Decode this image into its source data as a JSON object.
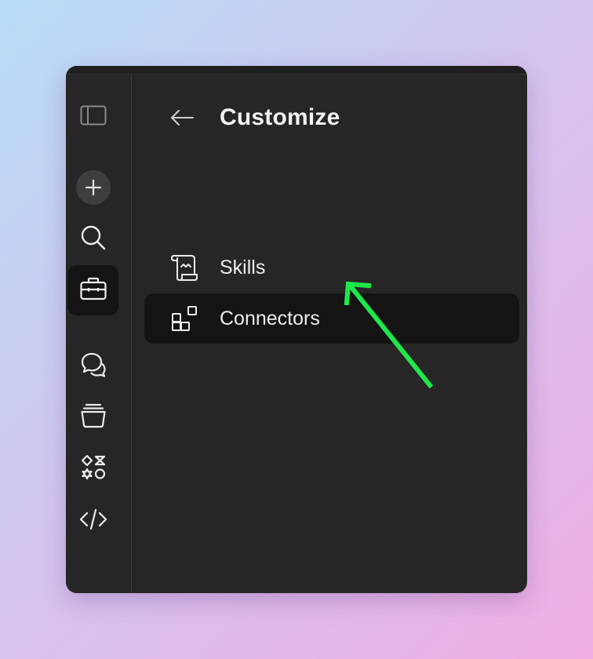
{
  "window": {
    "background": "#262626",
    "rail_active_bg": "#141414"
  },
  "sidebar": {
    "items": [
      {
        "name": "sidebar-toggle",
        "icon": "sidebar-panel-icon"
      },
      {
        "name": "new-chat",
        "icon": "plus-icon"
      },
      {
        "name": "search",
        "icon": "search-icon"
      },
      {
        "name": "customize",
        "icon": "briefcase-icon",
        "active": true
      },
      {
        "name": "chats",
        "icon": "chat-bubbles-icon"
      },
      {
        "name": "projects",
        "icon": "stack-icon"
      },
      {
        "name": "artifacts",
        "icon": "shapes-icon"
      },
      {
        "name": "code",
        "icon": "code-icon"
      }
    ]
  },
  "panel": {
    "back_icon": "arrow-left-icon",
    "title": "Customize",
    "items": [
      {
        "label": "Skills",
        "icon": "scroll-icon",
        "selected": false
      },
      {
        "label": "Connectors",
        "icon": "connectors-grid-icon",
        "selected": true
      }
    ]
  },
  "annotation": {
    "icon": "green-arrow-icon",
    "color": "#1ee84a"
  }
}
